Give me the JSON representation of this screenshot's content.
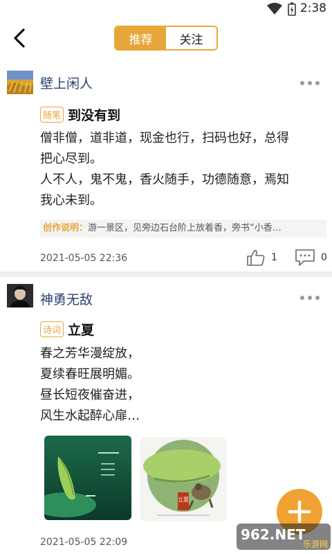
{
  "status": {
    "time": "2:38"
  },
  "header": {
    "tabs": [
      {
        "label": "推荐"
      },
      {
        "label": "关注"
      }
    ]
  },
  "posts": [
    {
      "user": "壁上闲人",
      "tag": "随笔",
      "title": "到没有到",
      "lines": [
        "僧非僧，道非道，现金也行，扫码也好，总得",
        "把心尽到。",
        "人不人，鬼不鬼，香火随手，功德随意，焉知",
        "我心未到。"
      ],
      "note_label": "创作说明：",
      "note_text": "游一景区，见旁边石台阶上放着香，旁书“小香…",
      "date": "2021-05-05 22:36",
      "likes": "1",
      "comments": "0"
    },
    {
      "user": "神勇无敌",
      "tag": "诗词",
      "title": "立夏",
      "lines": [
        "春之芳华漫绽放，",
        "夏续春旺展明媚。",
        "昼长短夜催奋进，",
        "风生水起醉心扉…"
      ],
      "date": "2021-05-05 22:09",
      "image2_text": "立夏"
    }
  ],
  "watermark": {
    "text": "962.NET",
    "sub": "乐游网"
  },
  "colors": {
    "accent": "#e8a63a",
    "fab": "#f0a232",
    "username": "#2c3f70"
  }
}
